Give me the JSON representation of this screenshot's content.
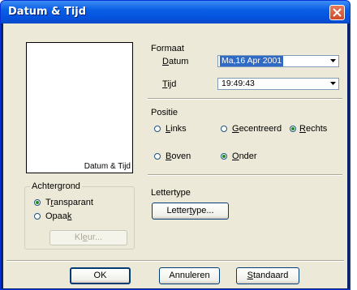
{
  "window": {
    "title": "Datum & Tijd"
  },
  "preview": {
    "text": "Datum & Tijd"
  },
  "formaat": {
    "heading": "Formaat",
    "datum": {
      "label_u": "D",
      "label_rest": "atum",
      "value": "Ma,16 Apr 2001"
    },
    "tijd": {
      "label_u": "T",
      "label_rest": "ijd",
      "value": "19:49:43"
    }
  },
  "positie": {
    "heading": "Positie",
    "links": {
      "u": "L",
      "rest": "inks",
      "selected": false
    },
    "gecentreerd": {
      "u": "G",
      "rest": "ecentreerd",
      "selected": false
    },
    "rechts": {
      "u": "R",
      "rest": "echts",
      "selected": true
    },
    "boven": {
      "u": "B",
      "rest": "oven",
      "selected": false
    },
    "onder": {
      "u": "O",
      "rest": "nder",
      "selected": true
    }
  },
  "achtergrond": {
    "legend": "Achtergrond",
    "transparant": {
      "pre": "T",
      "u": "r",
      "rest": "ansparant",
      "selected": true
    },
    "opaak": {
      "pre": "Opaa",
      "u": "k",
      "rest": "",
      "selected": false
    },
    "kleur_btn": {
      "pre": "Kl",
      "u": "e",
      "rest": "ur..."
    }
  },
  "lettertype": {
    "heading": "Lettertype",
    "button": {
      "pre": "Letter",
      "u": "t",
      "rest": "ype..."
    }
  },
  "buttons": {
    "ok": "OK",
    "annuleren": "Annuleren",
    "standaard": {
      "u": "S",
      "rest": "tandaard"
    }
  }
}
